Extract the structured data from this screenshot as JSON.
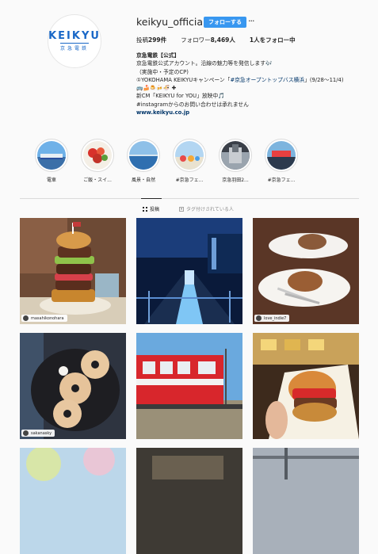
{
  "profile": {
    "avatar_logo": "KEIKYU",
    "avatar_logo_sub": "京急電鉄",
    "username": "keikyu_official",
    "follow_label": "フォローする",
    "more_label": "···",
    "stats": [
      {
        "label": "投稿",
        "value": "299件"
      },
      {
        "label": "フォロワー",
        "value": "8,469人"
      },
      {
        "label": "",
        "value": "1人をフォロー中"
      }
    ],
    "bio": {
      "name": "京急電鉄【公式】",
      "line1": "京急電鉄公式アカウント。沿線の魅力等を発信します🎶",
      "line2": "（実施中・予定のCP)",
      "line3_prefix": "①YOKOHAMA KEIKYUキャンペーン「",
      "line3_hashtag": "#京急オープントップバス横浜",
      "line3_suffix": "」(9/28〜11/4)",
      "line4": "🚌🍰🍮🍻🍜 ✚",
      "line5": "新CM「KEIKYU for YOU」放映中🎵",
      "line6": "#instagramからのお問い合わせは承れません",
      "link": "www.keikyu.co.jp"
    }
  },
  "highlights": [
    {
      "label": "電車"
    },
    {
      "label": "ご飯・スイ..."
    },
    {
      "label": "風景・自然"
    },
    {
      "label": "#京急フェ..."
    },
    {
      "label": "京急羽田2..."
    },
    {
      "label": "#京急フェ..."
    }
  ],
  "tabs": [
    {
      "label": "投稿",
      "icon": "grid-icon",
      "active": true
    },
    {
      "label": "タグ付けされている人",
      "icon": "tag-icon",
      "active": false
    }
  ],
  "posts": [
    {
      "tag_user": "masahikonohara"
    },
    {
      "tag_user": ""
    },
    {
      "tag_user": "love_indie7"
    },
    {
      "tag_user": "sakanasky"
    },
    {
      "tag_user": ""
    },
    {
      "tag_user": ""
    }
  ],
  "colors": {
    "accent": "#3897f0",
    "brand": "#1a68c7",
    "link": "#003569",
    "background": "#fafafa"
  }
}
